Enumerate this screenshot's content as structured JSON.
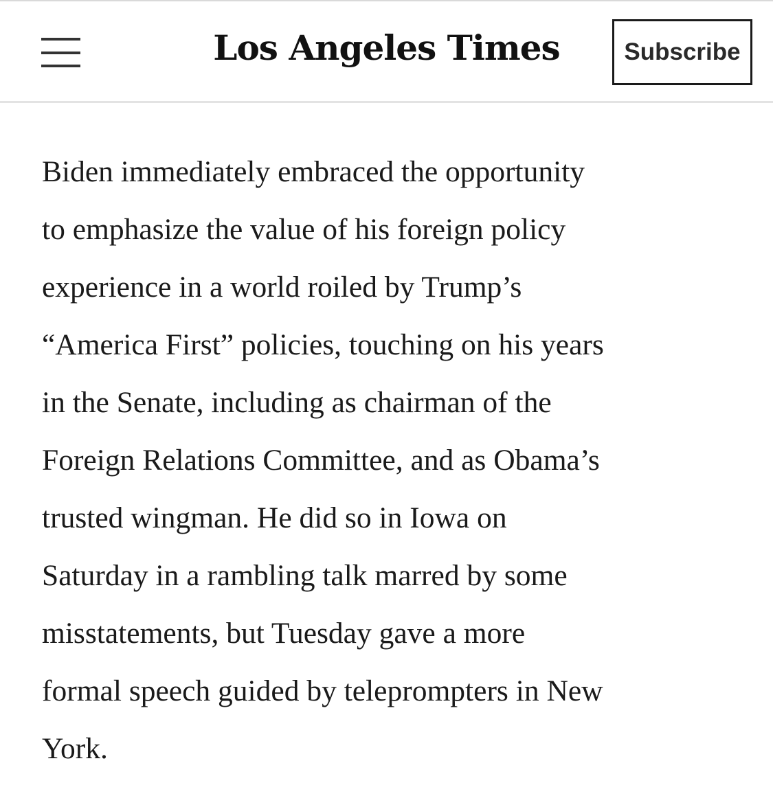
{
  "header": {
    "menu_icon": "hamburger-menu-icon",
    "logo_text": "Los Angeles Times",
    "subscribe_label": "Subscribe"
  },
  "article": {
    "paragraph": "Biden immediately embraced the opportunity\nto emphasize the value of his foreign policy\nexperience in a world roiled by Trump’s\n“America First” policies, touching on his years\nin the Senate, including as chairman of the\nForeign Relations Committee, and as Obama’s\ntrusted wingman. He did so in Iowa on\nSaturday in a rambling talk marred by some\nmisstatements, but Tuesday gave a more\nformal speech guided by teleprompters in New\nYork."
  },
  "colors": {
    "text": "#1a1a1a",
    "divider": "#e3e3e3",
    "background": "#ffffff"
  }
}
